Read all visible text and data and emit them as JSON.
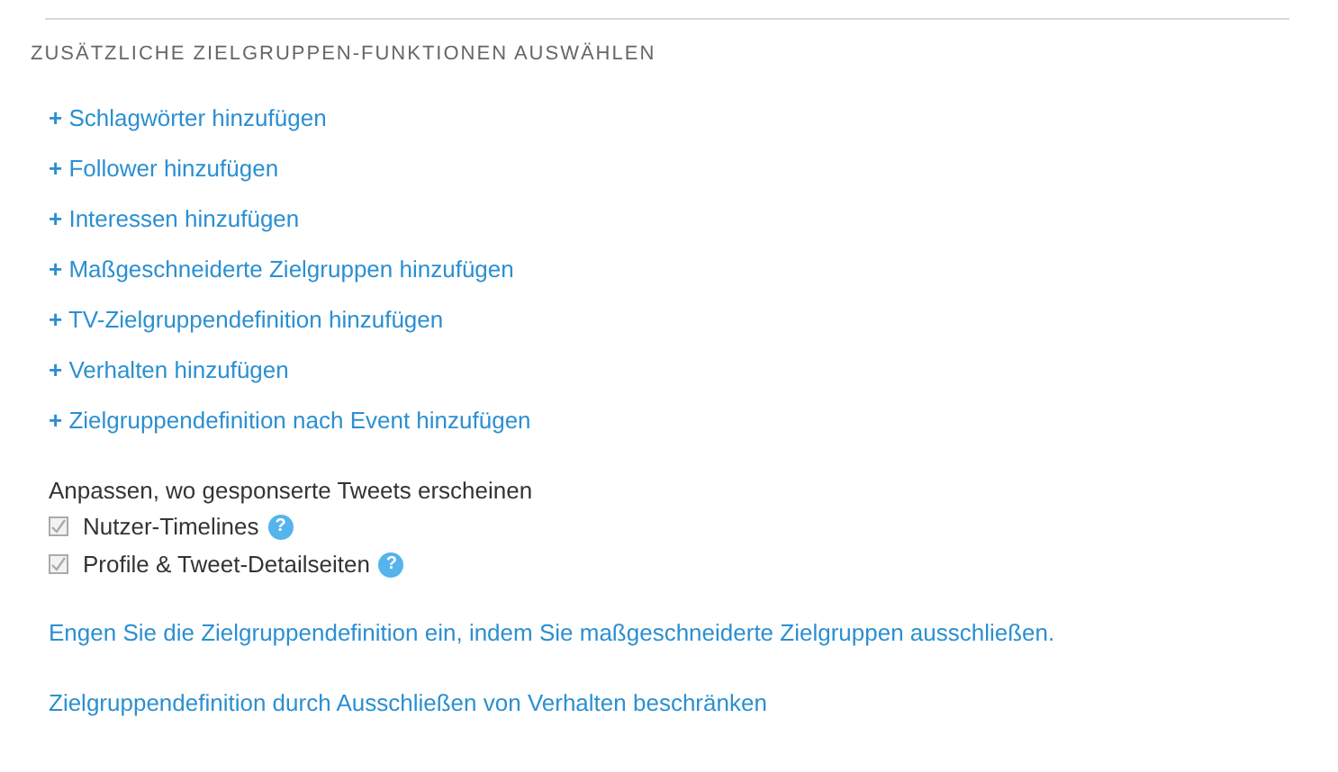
{
  "section_title": "ZUSÄTZLICHE ZIELGRUPPEN-FUNKTIONEN AUSWÄHLEN",
  "add_links": [
    {
      "label": "**+** Schlagwörter hinzufügen"
    },
    {
      "label": "**+** Follower hinzufügen"
    },
    {
      "label": "**+** Interessen hinzufügen"
    },
    {
      "label": "**+** Maßgeschneiderte Zielgruppen hinzufügen"
    },
    {
      "label": "**+** TV-Zielgruppendefinition hinzufügen"
    },
    {
      "label": "**+** Verhalten hinzufügen"
    },
    {
      "label": "**+** Zielgruppendefinition nach Event hinzufügen"
    }
  ],
  "placements": {
    "label": "Anpassen, wo gesponserte Tweets erscheinen",
    "options": [
      {
        "label": "Nutzer-Timelines",
        "checked": true,
        "disabled": true,
        "help": "?"
      },
      {
        "label": "Profile & Tweet-Detailseiten",
        "checked": true,
        "disabled": true,
        "help": "?"
      }
    ]
  },
  "exclusion_links": [
    "Engen Sie die Zielgruppendefinition ein, indem Sie maßgeschneiderte Zielgruppen ausschließen.",
    "Zielgruppendefinition durch Ausschließen von Verhalten beschränken"
  ]
}
